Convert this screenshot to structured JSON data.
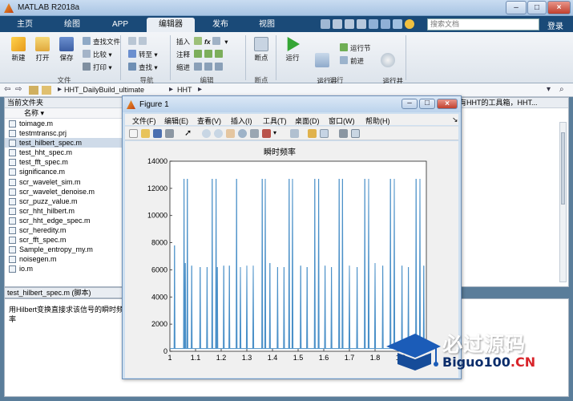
{
  "window": {
    "title": "MATLAB R2018a",
    "minimize": "–",
    "restore": "□",
    "close": "×"
  },
  "ribbon_tabs": [
    "主页",
    "绘图",
    "APP",
    "编辑器",
    "发布",
    "视图"
  ],
  "search": {
    "placeholder": "搜索文档"
  },
  "login": "登录",
  "ribbon": {
    "new": "新建",
    "open": "打开",
    "save": "保存",
    "find_files": "查找文件",
    "compare": "比较",
    "print": "打印",
    "goto": "转至",
    "find": "查找",
    "insert": "插入",
    "comment": "注释",
    "indent": "缩进",
    "breakpoints": "断点",
    "run": "运行",
    "run_advance": "运行并\n前进",
    "run_section": "运行节",
    "advance": "前进",
    "run_time": "运行并\n计时",
    "groups": {
      "file": "文件",
      "navigate": "导航",
      "edit": "编辑",
      "breakpoints": "断点",
      "run": "运行"
    }
  },
  "path": {
    "crumbs": [
      "HHT_DailyBuild_ultimate",
      "HHT"
    ]
  },
  "folder_panel": {
    "title": "当前文件夹",
    "column": "名称",
    "files": [
      "toimage.m",
      "testmtransc.prj",
      "test_hilbert_spec.m",
      "test_hht_spec.m",
      "test_fft_spec.m",
      "significance.m",
      "scr_wavelet_sim.m",
      "scr_wavelet_denoise.m",
      "scr_puzz_value.m",
      "scr_hht_hilbert.m",
      "scr_hht_edge_spec.m",
      "scr_heredity.m",
      "scr_fft_spec.m",
      "Sample_entropy_my.m",
      "noisegen.m",
      "io.m"
    ],
    "selected_index": 2
  },
  "detail_panel": {
    "title": "test_hilbert_spec.m  (脚本)"
  },
  "cmd": {
    "text": "用Hilbert变换直接求该信号的瞬时频率"
  },
  "right_panel": {
    "title": "有HHT的工具箱，HHT..."
  },
  "figure": {
    "title": "Figure 1",
    "menu": [
      "文件(F)",
      "编辑(E)",
      "查看(V)",
      "插入(I)",
      "工具(T)",
      "桌面(D)",
      "窗口(W)",
      "帮助(H)"
    ]
  },
  "chart_data": {
    "type": "line",
    "title": "瞬时频率",
    "xlabel": "",
    "ylabel": "",
    "xlim": [
      1,
      2
    ],
    "ylim": [
      0,
      14000
    ],
    "xticks": [
      "1",
      "1.1",
      "1.2",
      "1.3",
      "1.4",
      "1.5",
      "1.6",
      "1.7",
      "1.8",
      "1.9",
      "2"
    ],
    "yticks": [
      "0",
      "2000",
      "4000",
      "6000",
      "8000",
      "10000",
      "12000",
      "14000"
    ],
    "baseline": 200,
    "spikes": [
      {
        "x": 1.018,
        "y": 7800
      },
      {
        "x": 1.055,
        "y": 12700
      },
      {
        "x": 1.06,
        "y": 6500
      },
      {
        "x": 1.068,
        "y": 12700
      },
      {
        "x": 1.085,
        "y": 6300
      },
      {
        "x": 1.118,
        "y": 6200
      },
      {
        "x": 1.145,
        "y": 6200
      },
      {
        "x": 1.165,
        "y": 12700
      },
      {
        "x": 1.18,
        "y": 12700
      },
      {
        "x": 1.185,
        "y": 6200
      },
      {
        "x": 1.21,
        "y": 6300
      },
      {
        "x": 1.232,
        "y": 6300
      },
      {
        "x": 1.26,
        "y": 12700
      },
      {
        "x": 1.275,
        "y": 6200
      },
      {
        "x": 1.3,
        "y": 6300
      },
      {
        "x": 1.325,
        "y": 6300
      },
      {
        "x": 1.36,
        "y": 12700
      },
      {
        "x": 1.372,
        "y": 12700
      },
      {
        "x": 1.39,
        "y": 6500
      },
      {
        "x": 1.42,
        "y": 6200
      },
      {
        "x": 1.445,
        "y": 6200
      },
      {
        "x": 1.465,
        "y": 12700
      },
      {
        "x": 1.478,
        "y": 12700
      },
      {
        "x": 1.51,
        "y": 6300
      },
      {
        "x": 1.535,
        "y": 6200
      },
      {
        "x": 1.565,
        "y": 12700
      },
      {
        "x": 1.58,
        "y": 12700
      },
      {
        "x": 1.605,
        "y": 6300
      },
      {
        "x": 1.63,
        "y": 6200
      },
      {
        "x": 1.66,
        "y": 12700
      },
      {
        "x": 1.673,
        "y": 12700
      },
      {
        "x": 1.7,
        "y": 6300
      },
      {
        "x": 1.73,
        "y": 6200
      },
      {
        "x": 1.76,
        "y": 12700
      },
      {
        "x": 1.775,
        "y": 12700
      },
      {
        "x": 1.8,
        "y": 6500
      },
      {
        "x": 1.83,
        "y": 6300
      },
      {
        "x": 1.86,
        "y": 12700
      },
      {
        "x": 1.875,
        "y": 12700
      },
      {
        "x": 1.905,
        "y": 6300
      },
      {
        "x": 1.93,
        "y": 6200
      },
      {
        "x": 1.96,
        "y": 12700
      },
      {
        "x": 1.975,
        "y": 12700
      },
      {
        "x": 1.99,
        "y": 6300
      }
    ],
    "color": "#4a90c8",
    "grid": false
  },
  "watermark": {
    "cn": "必过源码",
    "latin": "Biguo100",
    "suffix": ".CN"
  }
}
